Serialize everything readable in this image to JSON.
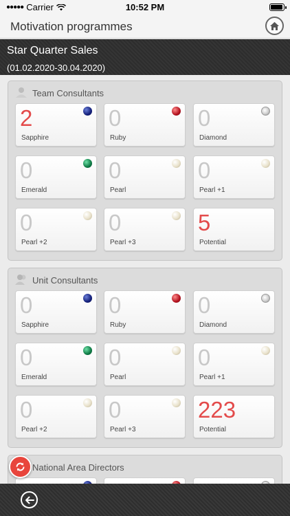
{
  "status": {
    "carrier": "Carrier",
    "time": "10:52 PM"
  },
  "nav": {
    "title": "Motivation programmes"
  },
  "programme": {
    "name": "Star Quarter Sales",
    "period": "(01.02.2020-30.04.2020)"
  },
  "groups": [
    {
      "label": "Team Consultants",
      "tiles": [
        {
          "value": "2",
          "label": "Sapphire"
        },
        {
          "value": "0",
          "label": "Ruby"
        },
        {
          "value": "0",
          "label": "Diamond"
        },
        {
          "value": "0",
          "label": "Emerald"
        },
        {
          "value": "0",
          "label": "Pearl"
        },
        {
          "value": "0",
          "label": "Pearl +1"
        },
        {
          "value": "0",
          "label": "Pearl +2"
        },
        {
          "value": "0",
          "label": "Pearl +3"
        },
        {
          "value": "5",
          "label": "Potential"
        }
      ]
    },
    {
      "label": "Unit Consultants",
      "tiles": [
        {
          "value": "0",
          "label": "Sapphire"
        },
        {
          "value": "0",
          "label": "Ruby"
        },
        {
          "value": "0",
          "label": "Diamond"
        },
        {
          "value": "0",
          "label": "Emerald"
        },
        {
          "value": "0",
          "label": "Pearl"
        },
        {
          "value": "0",
          "label": "Pearl +1"
        },
        {
          "value": "0",
          "label": "Pearl +2"
        },
        {
          "value": "0",
          "label": "Pearl +3"
        },
        {
          "value": "223",
          "label": "Potential"
        }
      ]
    },
    {
      "label": "National Area Directors",
      "tiles": []
    }
  ],
  "colors": {
    "highlight": "#e34b4b",
    "fab": "#e8453c",
    "header": "#2d2d2d"
  }
}
